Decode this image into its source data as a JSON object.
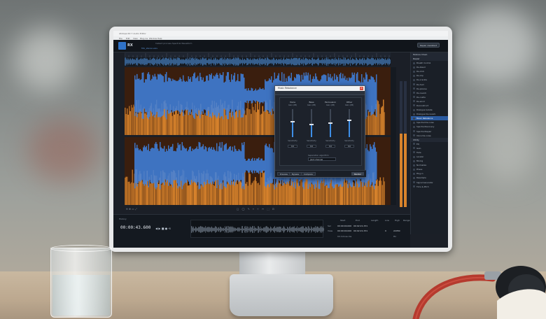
{
  "app": {
    "title": "iZotope RX 7 Audio Editor",
    "logo": "RX",
    "file_tab": "Mix_stereo.wav",
    "repair_assistant": "Repair Assistant",
    "menu": [
      "File",
      "Edit",
      "View",
      "Plug-ins",
      "Window",
      "Help"
    ],
    "top_tools": "Instant process  Spectral  Waveform"
  },
  "modules": {
    "sections": [
      "Module Chain",
      "Repair"
    ],
    "items": [
      "Breath Control",
      "De-bleed",
      "De-click",
      "De-clip",
      "De-crackle",
      "De-hum",
      "De-plosive",
      "De-reverb",
      "De-rustle",
      "De-wind",
      "Deconstruct",
      "Dialogue Isolate",
      "Dialogue De-reverb",
      "Music Rebalance",
      "Spectral De-noise",
      "Spectral Recovery",
      "Spectral Repair",
      "Voice De-noise"
    ],
    "active_item": "Music Rebalance",
    "utility_head": "Utility",
    "utility_items": [
      "EQ",
      "Gain",
      "Fade",
      "Leveler",
      "Mixing",
      "Normalize",
      "Phase",
      "Plug-in",
      "Resample",
      "Signal Generator",
      "Time & Pitch"
    ]
  },
  "dialog": {
    "title": "Music Rebalance",
    "channels": [
      {
        "name": "Voice",
        "sub": "Gain (dB)",
        "sens_label": "Sensitivity",
        "value": "0.0",
        "level": 0.55
      },
      {
        "name": "Bass",
        "sub": "Gain (dB)",
        "sens_label": "Sensitivity",
        "value": "0.0",
        "level": 0.45
      },
      {
        "name": "Percussion",
        "sub": "Gain (dB)",
        "sens_label": "Sensitivity",
        "value": "0.0",
        "level": 0.5
      },
      {
        "name": "Other",
        "sub": "Gain (dB)",
        "sens_label": "Sensitivity",
        "value": "0.0",
        "level": 0.6
      }
    ],
    "separation_label": "Separation algorithm",
    "separation_value": "Joint channel",
    "buttons": {
      "preview": "Preview",
      "bypass": "Bypass",
      "compare": "Compare",
      "render": "Render"
    }
  },
  "transport": {
    "timecode": "00:00:43.600",
    "controls": "◀ ▶ ■ ● ⟲"
  },
  "selection": {
    "headers": [
      "Start",
      "End",
      "Length",
      "Low",
      "High",
      "Range"
    ],
    "sel_label": "Sel",
    "view_label": "View",
    "sel_start": "00:00:00.000",
    "sel_end": "00:02:21.331",
    "view_start": "00:00:00.000",
    "view_end": "00:02:21.331",
    "low": "0",
    "high": "22050",
    "format": "hh:mm:ss.ms",
    "units": "Hz"
  },
  "history": {
    "label": "History",
    "item": "Initial State"
  },
  "colors": {
    "wave_blue": "#3f82e0",
    "wave_orange": "#d8832c",
    "accent": "#2f72c8"
  }
}
